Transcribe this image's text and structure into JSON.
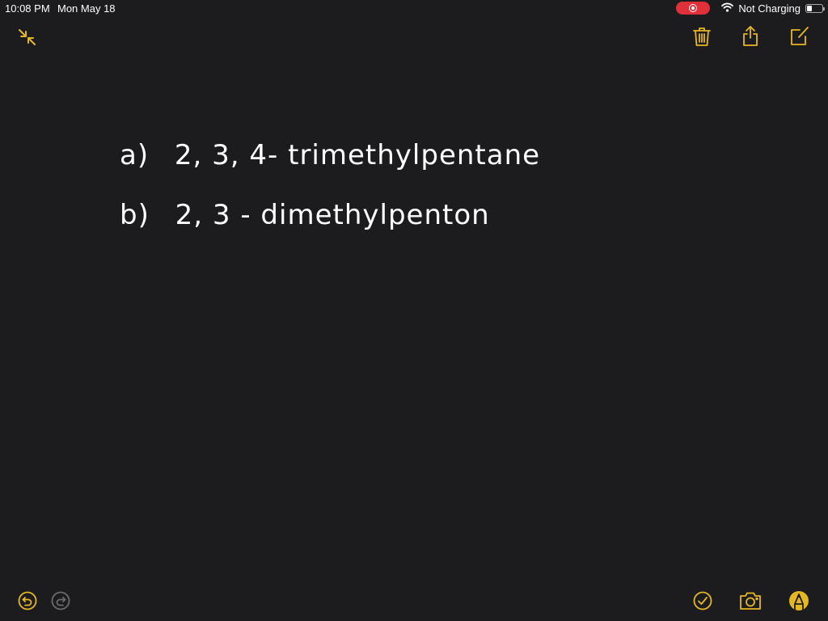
{
  "status_bar": {
    "time": "10:08 PM",
    "date": "Mon May 18",
    "screen_recording": true,
    "wifi_icon": "wifi-icon",
    "battery_status": "Not Charging",
    "battery_level": 0.35
  },
  "toolbar_top": {
    "left": [
      {
        "name": "collapse-icon",
        "label": "Exit full screen"
      }
    ],
    "right": [
      {
        "name": "trash-icon",
        "label": "Delete"
      },
      {
        "name": "share-icon",
        "label": "Share"
      },
      {
        "name": "compose-icon",
        "label": "New Note"
      }
    ]
  },
  "note": {
    "lines": [
      {
        "label": "a)",
        "text": "2, 3, 4- trimethylpentane"
      },
      {
        "label": "b)",
        "text": "2, 3 - dimethylpenton"
      }
    ]
  },
  "toolbar_bottom": {
    "left": [
      {
        "name": "undo-icon",
        "label": "Undo",
        "enabled": true
      },
      {
        "name": "redo-icon",
        "label": "Redo",
        "enabled": false
      }
    ],
    "right": [
      {
        "name": "checklist-icon",
        "label": "Checklist"
      },
      {
        "name": "camera-icon",
        "label": "Camera"
      },
      {
        "name": "markup-pen-icon",
        "label": "Markup"
      }
    ]
  },
  "colors": {
    "accent": "#e5b823",
    "background": "#1c1c1e",
    "disabled": "#6b6b6b",
    "recording": "#e0313b"
  }
}
